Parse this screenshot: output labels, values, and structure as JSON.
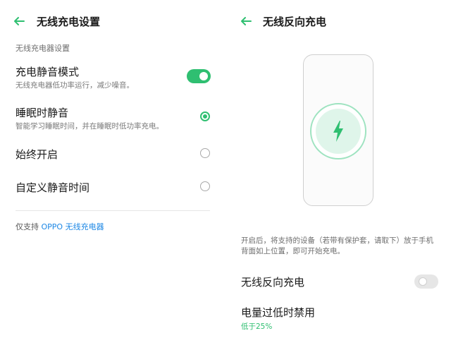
{
  "colors": {
    "accent": "#2fbf71",
    "link": "#1e88e5"
  },
  "left": {
    "title": "无线充电设置",
    "section_header": "无线充电器设置",
    "items": [
      {
        "title": "充电静音模式",
        "subtitle": "无线充电器低功率运行，减少噪音。",
        "control": "toggle",
        "state": "on"
      },
      {
        "title": "睡眠时静音",
        "subtitle": "智能学习睡眠时间，并在睡眠时低功率充电。",
        "control": "radio",
        "state": "checked"
      },
      {
        "title": "始终开启",
        "control": "radio",
        "state": "unchecked"
      },
      {
        "title": "自定义静音时间",
        "control": "radio",
        "state": "unchecked"
      }
    ],
    "footer_prefix": "仅支持",
    "footer_link": "OPPO 无线充电器"
  },
  "right": {
    "title": "无线反向充电",
    "illustration_icon": "lightning-bolt-icon",
    "description": "开启后，将支持的设备（若带有保护套，请取下）放于手机背面如上位置，即可开始充电。",
    "items": [
      {
        "title": "无线反向充电",
        "control": "toggle",
        "state": "off"
      },
      {
        "title": "电量过低时禁用",
        "subtitle": "低于25%"
      }
    ]
  }
}
